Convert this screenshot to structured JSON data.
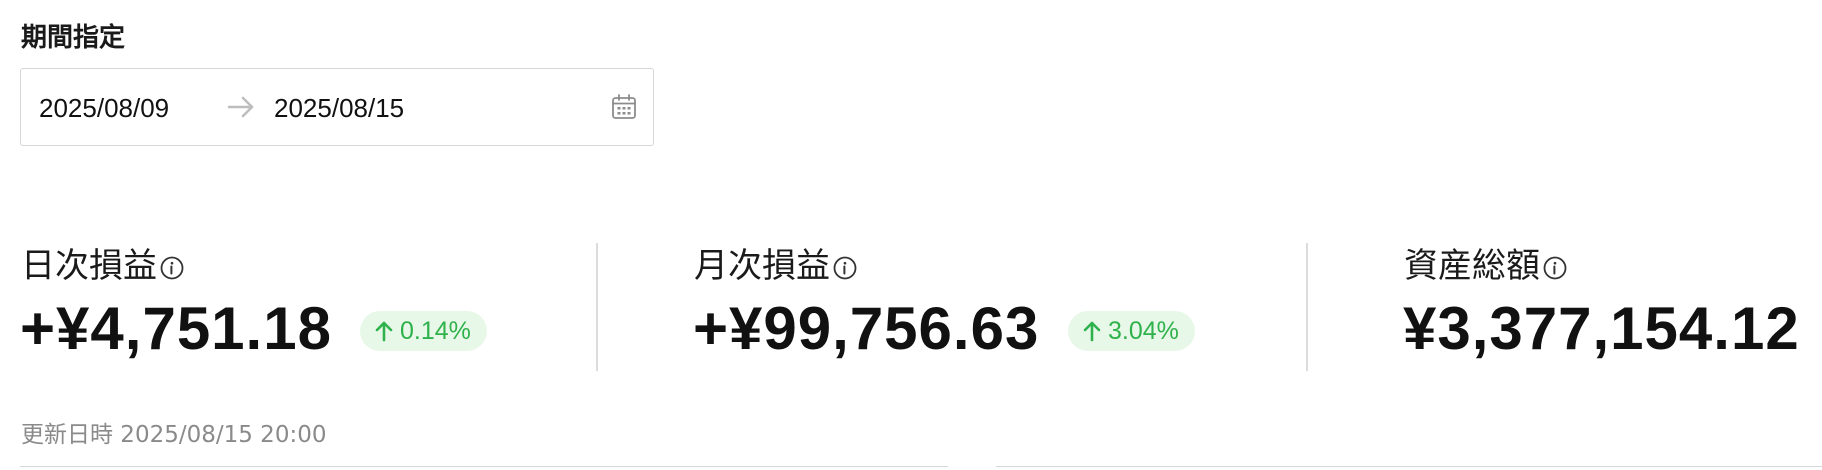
{
  "period": {
    "label": "期間指定",
    "start_date": "2025/08/09",
    "end_date": "2025/08/15",
    "arrow_icon": "arrow-right-icon",
    "calendar_icon": "calendar-icon"
  },
  "metrics": {
    "daily": {
      "label": "日次損益",
      "value": "+¥4,751.18",
      "change": "0.14%",
      "direction": "up"
    },
    "monthly": {
      "label": "月次損益",
      "value": "+¥99,756.63",
      "change": "3.04%",
      "direction": "up"
    },
    "total": {
      "label": "資産総額",
      "value": "¥3,377,154.12"
    }
  },
  "updated": {
    "text": "更新日時 2025/08/15 20:00"
  },
  "colors": {
    "positive": "#2fb24c",
    "positive_bg": "#e8f8e8",
    "border": "#d6d6d6",
    "muted_text": "#8a8a8a"
  }
}
